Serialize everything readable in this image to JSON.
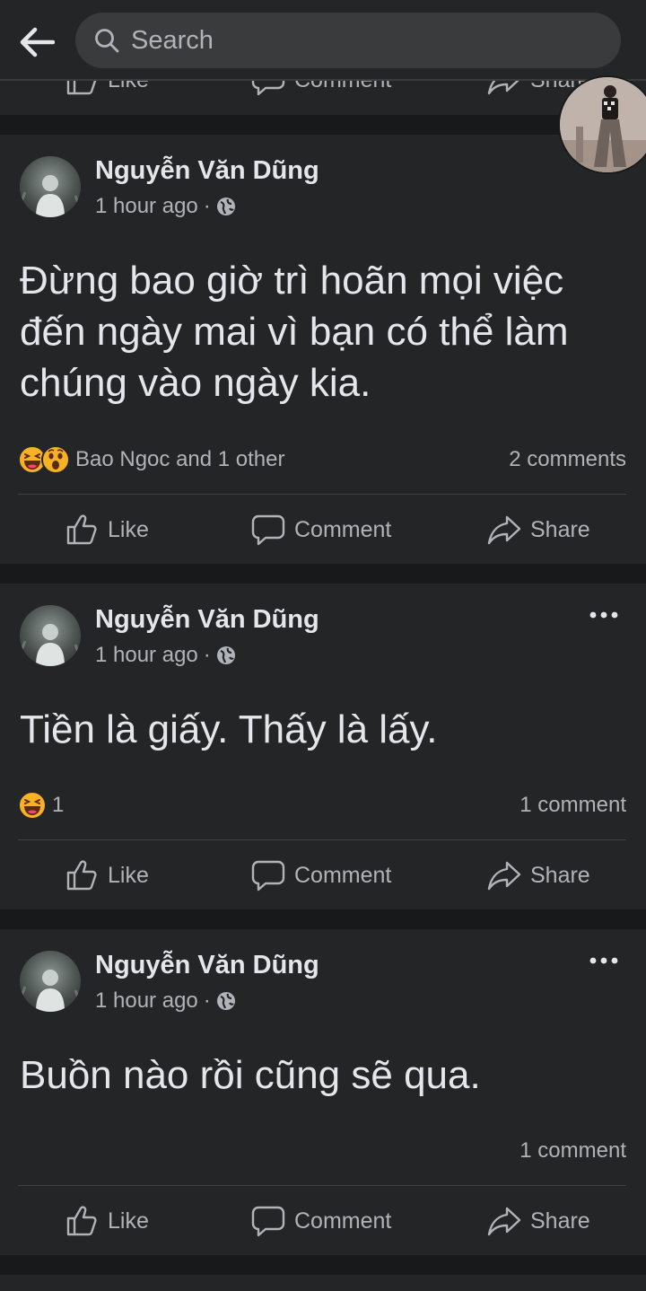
{
  "search": {
    "placeholder": "Search"
  },
  "icons": {
    "back": "arrow-left-icon",
    "search": "search-icon",
    "globe": "globe-icon",
    "more": "more-horizontal-icon",
    "like": "thumbs-up-icon",
    "comment": "comment-icon",
    "share": "share-icon",
    "laugh": "laugh-reaction-icon",
    "wow": "wow-reaction-icon"
  },
  "actions": {
    "like": "Like",
    "comment": "Comment",
    "share": "Share"
  },
  "posts": [
    {
      "author": "Nguyễn Văn Dũng",
      "time": "1 hour ago",
      "separator": "·",
      "text": "Đừng bao giờ trì hoãn mọi việc đến ngày mai vì bạn có thể làm chúng vào ngày kia.",
      "reactions_text": "Bao Ngoc and 1 other",
      "reactions": [
        "laugh",
        "wow"
      ],
      "comments": "2 comments"
    },
    {
      "author": "Nguyễn Văn Dũng",
      "time": "1 hour ago",
      "separator": "·",
      "text": "Tiền là giấy. Thấy là lấy.",
      "reactions_text": "1",
      "reactions": [
        "laugh"
      ],
      "comments": "1 comment"
    },
    {
      "author": "Nguyễn Văn Dũng",
      "time": "1 hour ago",
      "separator": "·",
      "text": "Buồn nào rồi cũng sẽ qua.",
      "reactions_text": "",
      "reactions": [],
      "comments": "1 comment"
    }
  ],
  "colors": {
    "background": "#18191a",
    "card": "#242526",
    "text_primary": "#e4e6eb",
    "text_secondary": "#b0b3b8",
    "laugh_yellow": "#f7b125",
    "laugh_mouth": "#5c2a0e"
  }
}
